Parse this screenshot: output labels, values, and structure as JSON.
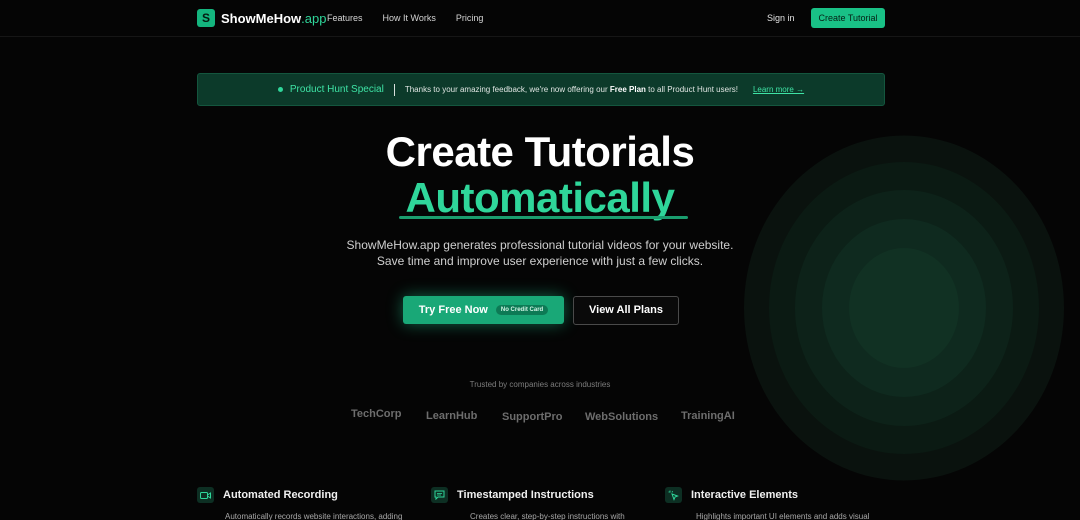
{
  "nav": {
    "logo_letter": "S",
    "logo_name": "ShowMeHow",
    "logo_domain": ".app",
    "links": [
      "Features",
      "How It Works",
      "Pricing"
    ],
    "signin": "Sign in",
    "cta": "Create Tutorial"
  },
  "banner": {
    "tag": "Product Hunt Special",
    "message_before": "Thanks to your amazing feedback, we're now offering our ",
    "message_bold": "Free Plan",
    "message_after": " to all Product Hunt users!",
    "link": "Learn more →"
  },
  "hero": {
    "title": "Create Tutorials",
    "accent": "Automatically",
    "subtitle_line1": "ShowMeHow.app generates professional tutorial videos for your website.",
    "subtitle_line2": "Save time and improve user experience with just a few clicks.",
    "primary_button": "Try Free Now",
    "primary_badge": "No Credit Card",
    "secondary_button": "View All Plans"
  },
  "trusted": {
    "label": "Trusted by companies across industries",
    "companies": [
      "TechCorp",
      "LearnHub",
      "SupportPro",
      "WebSolutions",
      "TrainingAI"
    ]
  },
  "features": [
    {
      "title": "Automated Recording",
      "icon": "video-camera-icon",
      "desc": "Automatically records website interactions, adding"
    },
    {
      "title": "Timestamped Instructions",
      "icon": "message-square-icon",
      "desc": "Creates clear, step-by-step instructions with"
    },
    {
      "title": "Interactive Elements",
      "icon": "pointer-click-icon",
      "desc": "Highlights important UI elements and adds visual"
    }
  ],
  "colors": {
    "accent": "#2fd69a",
    "button_green": "#19c186",
    "banner_bg": "#0c3a2a",
    "background": "#050505"
  }
}
